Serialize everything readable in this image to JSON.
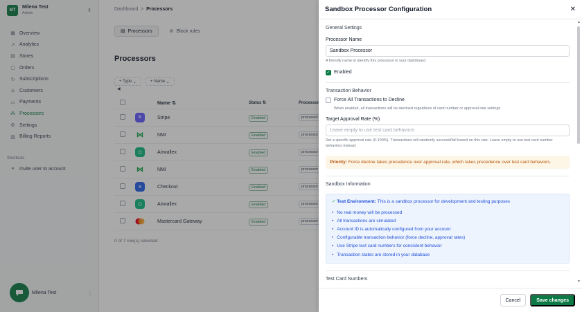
{
  "team": {
    "initials": "MT",
    "name": "Milena Test",
    "role": "Admin"
  },
  "sidebar": {
    "items": [
      {
        "label": "Overview",
        "icon": "grid-icon"
      },
      {
        "label": "Analytics",
        "icon": "chart-icon"
      },
      {
        "label": "Stores",
        "icon": "store-icon"
      },
      {
        "label": "Orders",
        "icon": "orders-icon"
      },
      {
        "label": "Subscriptions",
        "icon": "refresh-icon"
      },
      {
        "label": "Customers",
        "icon": "user-icon"
      },
      {
        "label": "Payments",
        "icon": "card-icon"
      },
      {
        "label": "Processors",
        "icon": "network-icon"
      },
      {
        "label": "Settings",
        "icon": "gear-icon"
      },
      {
        "label": "Billing Reports",
        "icon": "report-icon"
      }
    ],
    "shortcuts_label": "Shortcuts",
    "shortcut_item": "Invite user to account",
    "user_name": "Milena Test"
  },
  "breadcrumb": {
    "parent": "Dashboard",
    "separator": ">",
    "current": "Processors"
  },
  "tabs": [
    "Processors",
    "Block rules"
  ],
  "page_title": "Processors",
  "filters": {
    "type": "Type",
    "name": "Name"
  },
  "table": {
    "headers": {
      "name": "Name",
      "status": "Status",
      "processor": "Processor"
    },
    "rows": [
      {
        "name": "Stripe",
        "status": "Enabled",
        "processor": "processor"
      },
      {
        "name": "NMI",
        "status": "Enabled",
        "processor": "processor"
      },
      {
        "name": "Airwallex",
        "status": "Enabled",
        "processor": "processor"
      },
      {
        "name": "NMI",
        "status": "Enabled",
        "processor": "processor"
      },
      {
        "name": "Checkout",
        "status": "Enabled",
        "processor": "processor"
      },
      {
        "name": "Airwallex",
        "status": "Enabled",
        "processor": "processor"
      },
      {
        "name": "Mastercard Gateway",
        "status": "Enabled",
        "processor": "processor"
      }
    ],
    "selected_text": "0 of 7 row(s) selected."
  },
  "drawer": {
    "title": "Sandbox Processor Configuration",
    "general_title": "General Settings",
    "name_label": "Processor Name",
    "name_value": "Sandbox Processor",
    "name_hint": "A friendly name to identify this processor in your dashboard",
    "enabled_label": "Enabled",
    "tx_title": "Transaction Behavior",
    "force_label": "Force All Transactions to Decline",
    "force_hint": "When enabled, all transactions will be declined regardless of card number or approval rate settings",
    "rate_label": "Target Approval Rate (%)",
    "rate_placeholder": "Leave empty to use test card behaviors",
    "rate_hint": "Set a specific approval rate (0-100%). Transactions will randomly succeed/fail based on this rate. Leave empty to use test card number behaviors instead.",
    "priority_bold": "Priority:",
    "priority_text": "Force decline takes precedence over approval rate, which takes precedence over test card behaviors.",
    "sandbox_title": "Sandbox Information",
    "test_env_bold": "Test Environment:",
    "test_env_text": "This is a sandbox processor for development and testing purposes",
    "bullets": [
      "No real money will be processed",
      "All transactions are simulated",
      "Account ID is automatically configured from your account",
      "Configurable transaction behavior (force decline, approval rates)",
      "Use Stripe test card numbers for consistent behavior",
      "Transaction states are stored in your database"
    ],
    "cards_title": "Test Card Numbers",
    "cancel_label": "Cancel",
    "save_label": "Save changes"
  },
  "colors": {
    "accent": "#0d7a45",
    "info_text": "#1d4ed8",
    "warn_text": "#b45309"
  }
}
